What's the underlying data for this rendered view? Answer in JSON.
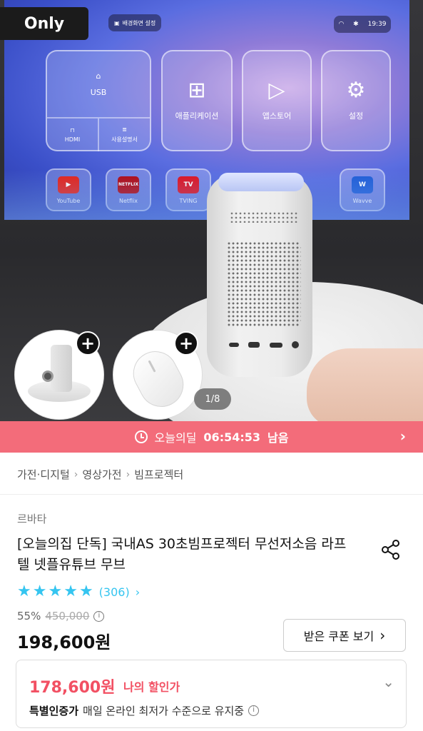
{
  "hero": {
    "badge": "Only",
    "pager": "1/8",
    "screen": {
      "top_button": "배경화면 설정",
      "clock": "19:39",
      "tiles": [
        {
          "label": "USB"
        },
        {
          "label": "애플리케이션"
        },
        {
          "label": "앱스토어"
        },
        {
          "label": "설정"
        }
      ],
      "usb_sub": [
        {
          "label": "HDMI"
        },
        {
          "label": "사용설명서"
        }
      ],
      "apps": [
        {
          "label": "YouTube",
          "color": "#e62117"
        },
        {
          "label": "Netflix",
          "color": "#b20710"
        },
        {
          "label": "TVING",
          "color": "#e0101d"
        },
        {
          "label": "Wavve",
          "color": "#1f5cd6"
        }
      ],
      "app_logos": [
        "▶",
        "NETFLIX",
        "TV",
        "W"
      ]
    }
  },
  "deal": {
    "label": "오늘의딜",
    "timer": "06:54:53",
    "suffix": "남음",
    "color": "#f36c7a"
  },
  "breadcrumb": [
    "가전·디지털",
    "영상가전",
    "빔프로젝터"
  ],
  "product": {
    "brand": "르바타",
    "title": "[오늘의집 단독] 국내AS 30초빔프로젝터 무선저소음 라프텔 넷플유튜브 무브",
    "rating_stars": 5,
    "review_count": "(306)",
    "discount_rate": "55%",
    "original_price": "450,000",
    "price": "198,600원",
    "coupon_button": "받은 쿠폰 보기",
    "benefit": {
      "price": "178,600원",
      "label": "나의 할인가",
      "certified": "특별인증가",
      "description": "매일 온라인 최저가 수준으로 유지중"
    }
  },
  "colors": {
    "accent_blue": "#35c5f0",
    "sale_red": "#f25063"
  }
}
